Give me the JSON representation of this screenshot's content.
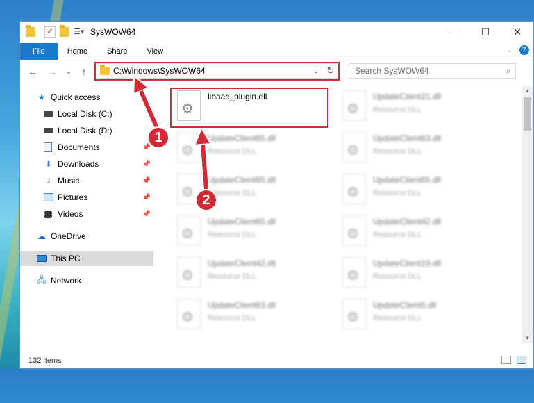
{
  "window": {
    "title": "SysWOW64",
    "controls": {
      "minimize": "—",
      "maximize": "☐",
      "close": "✕"
    }
  },
  "ribbon": {
    "tabs": [
      {
        "label": "File"
      },
      {
        "label": "Home"
      },
      {
        "label": "Share"
      },
      {
        "label": "View"
      }
    ],
    "help": "?"
  },
  "navigation": {
    "back": "←",
    "forward": "→",
    "recent": "⌄",
    "up": "↑",
    "address": "C:\\Windows\\SysWOW64",
    "refresh": "↻",
    "search_placeholder": "Search SysWOW64"
  },
  "sidebar": {
    "quick_access": "Quick access",
    "items": [
      {
        "label": "Local Disk (C:)",
        "icon": "drive-icon"
      },
      {
        "label": "Local Disk (D:)",
        "icon": "drive-icon"
      },
      {
        "label": "Documents",
        "icon": "documents-icon",
        "pinned": true
      },
      {
        "label": "Downloads",
        "icon": "downloads-icon",
        "pinned": true
      },
      {
        "label": "Music",
        "icon": "music-icon",
        "pinned": true
      },
      {
        "label": "Pictures",
        "icon": "pictures-icon",
        "pinned": true
      },
      {
        "label": "Videos",
        "icon": "videos-icon",
        "pinned": true
      }
    ],
    "onedrive": "OneDrive",
    "this_pc": "This PC",
    "network": "Network"
  },
  "files": {
    "highlighted": {
      "name": "libaac_plugin.dll"
    },
    "type_label": "Resource DLL",
    "left_column": [
      "UpdateClient65.dll",
      "UpdateClient65.dll",
      "UpdateClient65.dll",
      "UpdateClient42.dll",
      "UpdateClient63.dll"
    ],
    "right_column": [
      "UpdateClient21.dll",
      "UpdateClient63.dll",
      "UpdateClient65.dll",
      "UpdateClient42.dll",
      "UpdateClient19.dll",
      "UpdateClient5.dll"
    ]
  },
  "status": {
    "items_count": "132 items"
  },
  "annotations": {
    "step1": "1",
    "step2": "2"
  },
  "colors": {
    "accent": "#1979ca",
    "highlight": "#d32a36",
    "selected": "#d9d9d9"
  }
}
